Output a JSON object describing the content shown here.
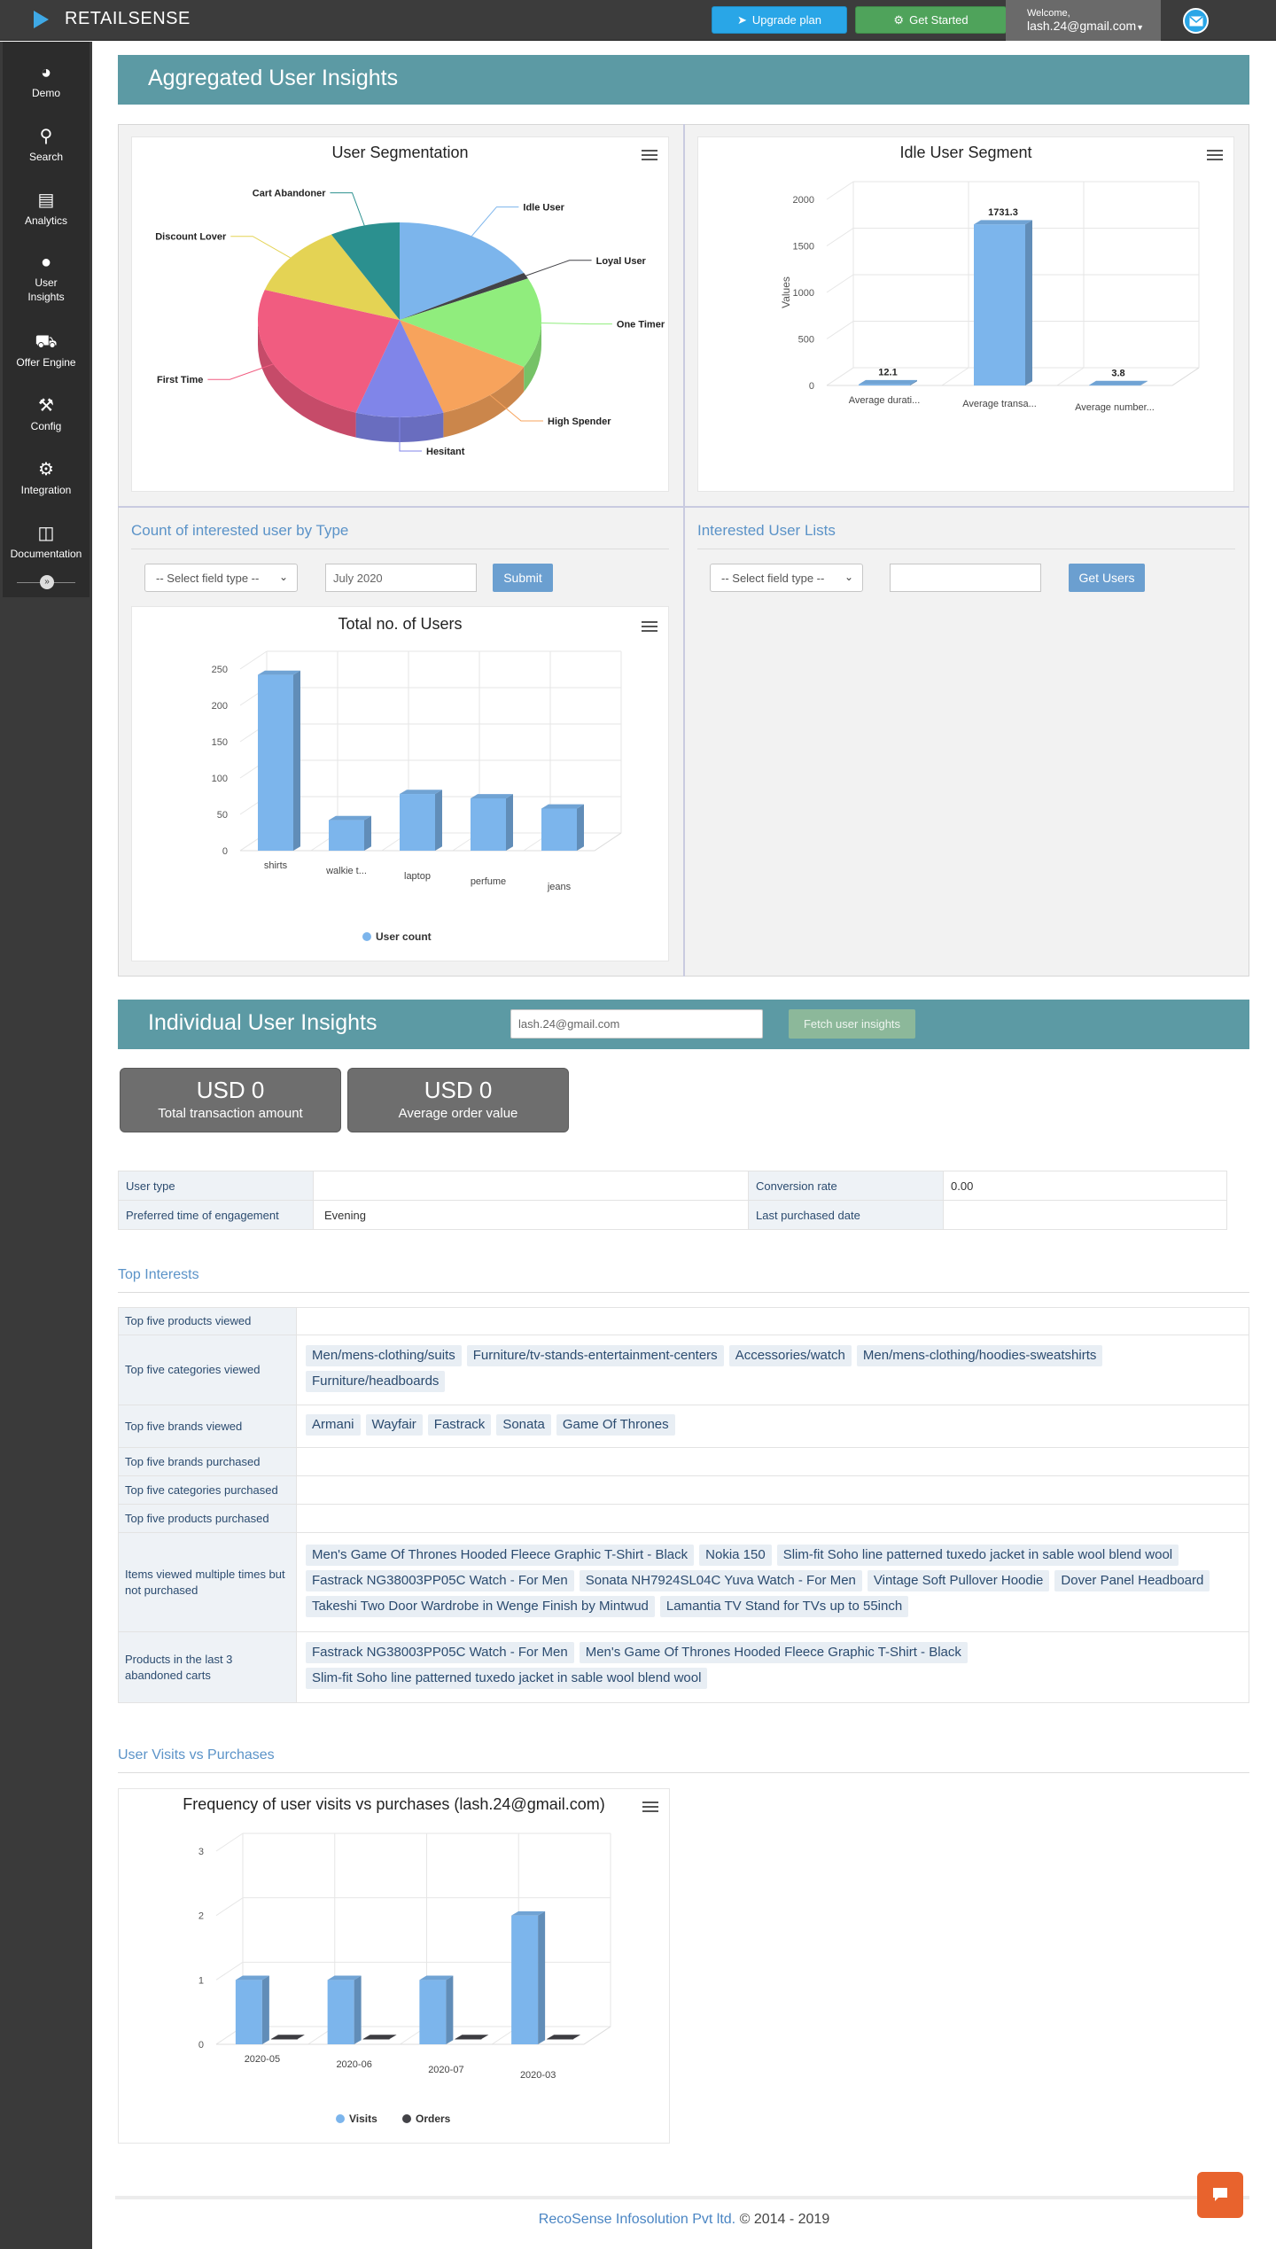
{
  "brand": {
    "name": "RETAILSENSE"
  },
  "topbar": {
    "upgrade_label": "Upgrade plan",
    "started_label": "Get Started",
    "welcome_label": "Welcome,",
    "user_email": "lash.24@gmail.com"
  },
  "sidebar": {
    "items": [
      {
        "label": "Demo",
        "icon": "dashboard-icon"
      },
      {
        "label": "Search",
        "icon": "search-icon"
      },
      {
        "label": "Analytics",
        "icon": "bar-chart-icon"
      },
      {
        "label": "User Insights",
        "icon": "user-icon"
      },
      {
        "label": "Offer Engine",
        "icon": "cart-icon"
      },
      {
        "label": "Config",
        "icon": "wrench-icon"
      },
      {
        "label": "Integration",
        "icon": "gears-icon"
      },
      {
        "label": "Documentation",
        "icon": "file-icon"
      }
    ]
  },
  "aggregated": {
    "title": "Aggregated User Insights",
    "count_title": "Count of interested user by Type",
    "count_select": "-- Select field type --",
    "count_date": "July 2020",
    "count_submit": "Submit",
    "lists_title": "Interested User Lists",
    "lists_select": "-- Select field type --",
    "lists_input": "",
    "lists_button": "Get Users"
  },
  "individual": {
    "title": "Individual User Insights",
    "email_value": "lash.24@gmail.com",
    "fetch_label": "Fetch user insights",
    "stats": [
      {
        "value": "USD 0",
        "label": "Total transaction amount"
      },
      {
        "value": "USD 0",
        "label": "Average order value"
      }
    ],
    "info": {
      "user_type_label": "User type",
      "user_type_value": "",
      "conversion_label": "Conversion rate",
      "conversion_value": "0.00",
      "pref_time_label": "Preferred time of engagement",
      "pref_time_value": "Evening",
      "last_purchase_label": "Last purchased date",
      "last_purchase_value": ""
    },
    "top_interests_title": "Top Interests",
    "interests": [
      {
        "label": "Top five products viewed",
        "tags": []
      },
      {
        "label": "Top five categories viewed",
        "tags": [
          "Men/mens-clothing/suits",
          "Furniture/tv-stands-entertainment-centers",
          "Accessories/watch",
          "Men/mens-clothing/hoodies-sweatshirts",
          "Furniture/headboards"
        ]
      },
      {
        "label": "Top five brands viewed",
        "tags": [
          "Armani",
          "Wayfair",
          "Fastrack",
          "Sonata",
          "Game Of Thrones"
        ]
      },
      {
        "label": "Top five brands purchased",
        "tags": []
      },
      {
        "label": "Top five categories purchased",
        "tags": []
      },
      {
        "label": "Top five products purchased",
        "tags": []
      },
      {
        "label": "Items viewed multiple times but not purchased",
        "tags": [
          "Men's Game Of Thrones Hooded Fleece Graphic T-Shirt - Black",
          "Nokia 150",
          "Slim-fit Soho line patterned tuxedo jacket in sable wool blend wool",
          "Fastrack NG38003PP05C Watch - For Men",
          "Sonata NH7924SL04C Yuva Watch - For Men",
          "Vintage Soft Pullover Hoodie",
          "Dover Panel Headboard",
          "Takeshi Two Door Wardrobe in Wenge Finish by Mintwud",
          "Lamantia TV Stand for TVs up to 55inch"
        ]
      },
      {
        "label": "Products in the last 3 abandoned carts",
        "tags": [
          "Fastrack NG38003PP05C Watch - For Men",
          "Men's Game Of Thrones Hooded Fleece Graphic T-Shirt - Black",
          "Slim-fit Soho line patterned tuxedo jacket in sable wool blend wool"
        ]
      }
    ],
    "visits_title": "User Visits vs Purchases"
  },
  "chart_data": [
    {
      "type": "pie",
      "title": "User Segmentation",
      "slices": [
        {
          "name": "Idle User",
          "value": 17,
          "color": "#7cb5ec"
        },
        {
          "name": "Loyal User",
          "value": 1,
          "color": "#434348"
        },
        {
          "name": "One Timer",
          "value": 15,
          "color": "#90ed7d"
        },
        {
          "name": "High Spender",
          "value": 12,
          "color": "#f7a35c"
        },
        {
          "name": "Hesitant",
          "value": 10,
          "color": "#8085e9"
        },
        {
          "name": "First Time",
          "value": 25,
          "color": "#f15c80"
        },
        {
          "name": "Discount Lover",
          "value": 12,
          "color": "#e4d354"
        },
        {
          "name": "Cart Abandoner",
          "value": 8,
          "color": "#2b908f"
        }
      ]
    },
    {
      "type": "bar",
      "title": "Idle User Segment",
      "categories": [
        "Average durati...",
        "Average transa...",
        "Average number..."
      ],
      "values": [
        12.1,
        1731.3,
        3.8
      ],
      "ylabel": "Values",
      "yticks": [
        0,
        500,
        1000,
        1500,
        2000
      ],
      "ylim": [
        0,
        2000
      ]
    },
    {
      "type": "bar",
      "title": "Total no. of Users",
      "categories": [
        "shirts",
        "walkie t...",
        "laptop",
        "perfume",
        "jeans"
      ],
      "series": [
        {
          "name": "User count",
          "values": [
            242,
            42,
            78,
            72,
            58
          ]
        }
      ],
      "yticks": [
        0,
        50,
        100,
        150,
        200,
        250
      ],
      "ylim": [
        0,
        250
      ]
    },
    {
      "type": "bar",
      "title": "Frequency of user visits vs purchases (lash.24@gmail.com)",
      "categories": [
        "2020-05",
        "2020-06",
        "2020-07",
        "2020-03"
      ],
      "series": [
        {
          "name": "Visits",
          "values": [
            1,
            1,
            1,
            2
          ]
        },
        {
          "name": "Orders",
          "values": [
            0,
            0,
            0,
            0
          ]
        }
      ],
      "yticks": [
        0,
        1,
        2,
        3
      ],
      "ylim": [
        0,
        3
      ]
    }
  ],
  "footer": {
    "company": "RecoSense Infosolution Pvt ltd.",
    "copyright": "© 2014 - 2019"
  }
}
